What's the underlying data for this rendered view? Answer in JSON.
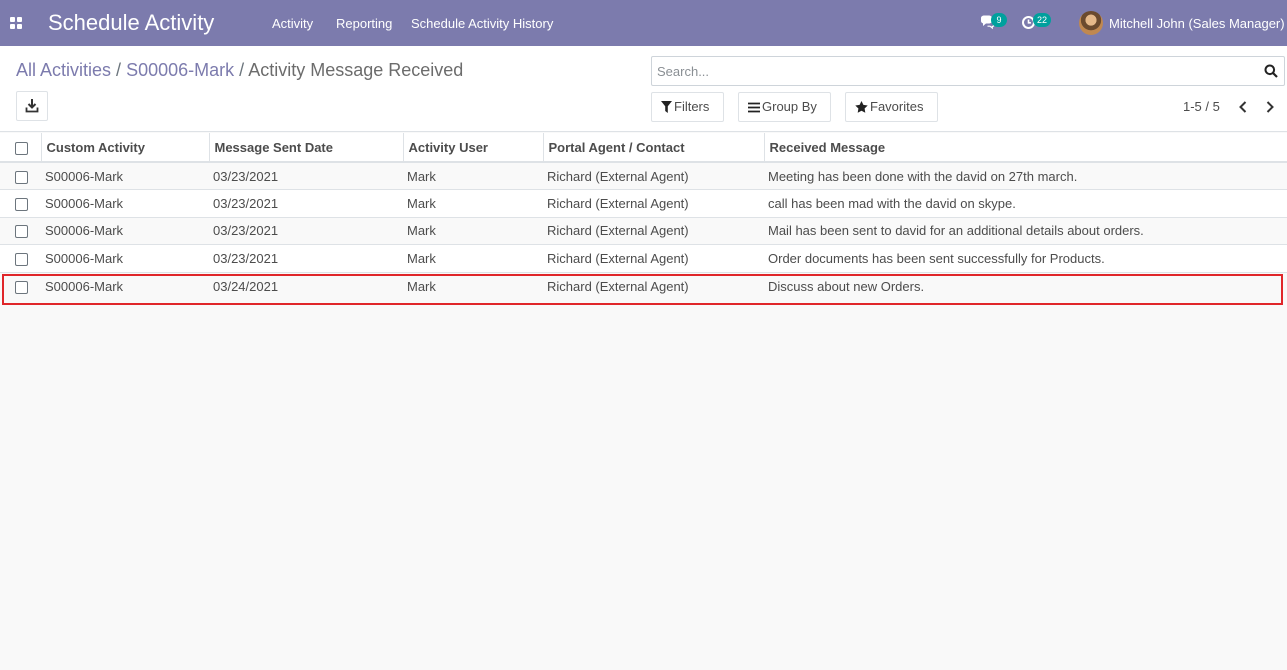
{
  "navbar": {
    "brand": "Schedule Activity",
    "menu": [
      {
        "label": "Activity"
      },
      {
        "label": "Reporting"
      },
      {
        "label": "Schedule Activity History"
      }
    ],
    "messages_badge": "9",
    "activities_badge": "22",
    "user_name": "Mitchell John (Sales Manager)",
    "icons": [
      "apps-grid-icon",
      "chat-icon",
      "clock-icon",
      "avatar"
    ],
    "brand_color": "#7c7bad",
    "badge_color": "#00a09d"
  },
  "breadcrumb": {
    "items": [
      "All Activities",
      "S00006-Mark"
    ],
    "separator": "/",
    "current": "Activity Message Received"
  },
  "search": {
    "placeholder": "Search...",
    "value": ""
  },
  "toolbar": {
    "filters_label": "Filters",
    "group_by_label": "Group By",
    "favorites_label": "Favorites",
    "download_icon": "download-icon"
  },
  "pager": {
    "value": "1-5 / 5"
  },
  "table": {
    "columns": [
      "Custom Activity",
      "Message Sent Date",
      "Activity User",
      "Portal Agent / Contact",
      "Received Message"
    ],
    "rows": [
      [
        "S00006-Mark",
        "03/23/2021",
        "Mark",
        "Richard (External Agent)",
        "Meeting has been done with the david on 27th march."
      ],
      [
        "S00006-Mark",
        "03/23/2021",
        "Mark",
        "Richard (External Agent)",
        "call has been mad with the david on skype."
      ],
      [
        "S00006-Mark",
        "03/23/2021",
        "Mark",
        "Richard (External Agent)",
        "Mail has been sent to david for an additional details about orders."
      ],
      [
        "S00006-Mark",
        "03/23/2021",
        "Mark",
        "Richard (External Agent)",
        "Order documents has been sent successfully for Products."
      ],
      [
        "S00006-Mark",
        "03/24/2021",
        "Mark",
        "Richard (External Agent)",
        "Discuss about new Orders."
      ]
    ],
    "highlighted_row": 5,
    "highlight_color": "#e0262a"
  }
}
